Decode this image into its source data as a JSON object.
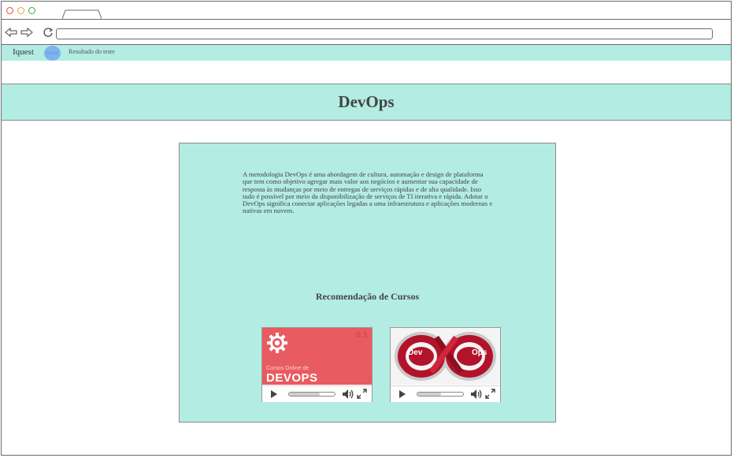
{
  "site": {
    "brand": "Iquest",
    "nav_pill": "Home",
    "nav_link": "Resultado do teste"
  },
  "page": {
    "title": "DevOps",
    "description": "A metodologia DevOps é uma abordagem de cultura, automação e design de plataforma que tem como objetivo agregar mais valor aos negócios e aumentar sua capacidade de resposta às mudanças por meio de entregas de serviços rápidas e de alta qualidade. Isso tudo é possível por meio da disponibilização de serviços de TI iterativa e rápida. Adotar o DevOps significa conectar aplicações legadas a uma infraestrutura e aplicações modernas e nativas em nuvem.",
    "recommendations_title": "Recomendação de Cursos"
  },
  "videos": [
    {
      "thumb_small": "Cursos Online de",
      "thumb_big": "DEVOPS",
      "thumb_number": "0.1",
      "progress": 0.68,
      "icon": "gear-icon"
    },
    {
      "thumb_left": "Dev",
      "thumb_right": "Ops",
      "progress": 0.52,
      "icon": "infinity-icon"
    }
  ],
  "colors": {
    "mint": "#b3ece3",
    "pill": "#7fb3ef",
    "video1_bg": "#e85b60",
    "video2_red": "#b3132a"
  }
}
